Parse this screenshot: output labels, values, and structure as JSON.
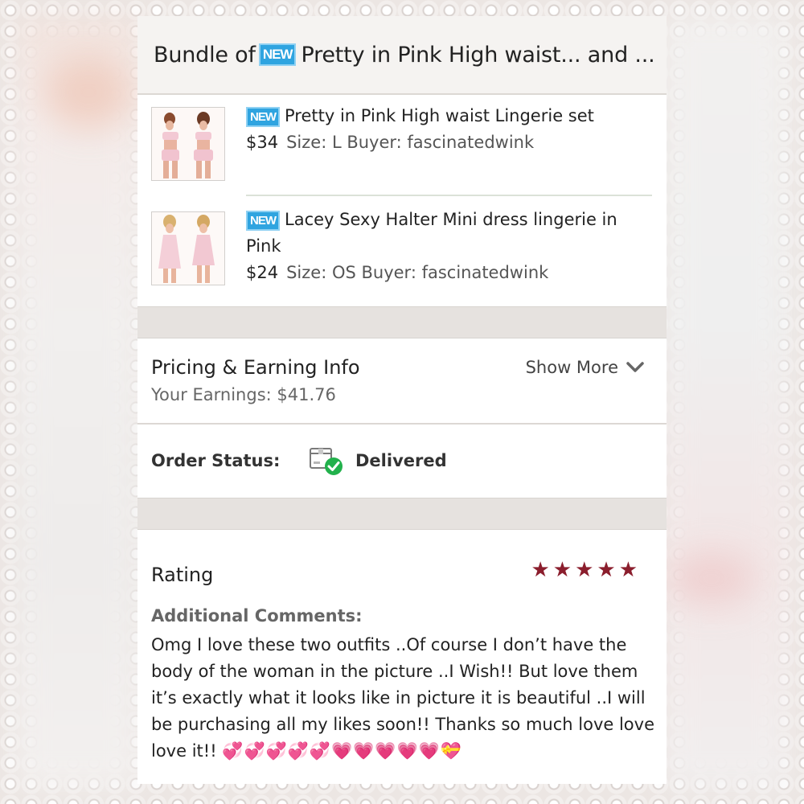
{
  "title": {
    "prefix": "Bundle of",
    "badge": "NEW",
    "text": "Pretty in Pink High waist... and ..."
  },
  "items": [
    {
      "badge": "NEW",
      "name": "Pretty in Pink High waist Lingerie set",
      "price": "$34",
      "meta": "Size: L  Buyer: fascinatedwink"
    },
    {
      "badge": "NEW",
      "name": "Lacey Sexy Halter Mini dress lingerie in Pink",
      "price": "$24",
      "meta": "Size: OS  Buyer: fascinatedwink"
    }
  ],
  "pricing": {
    "title": "Pricing & Earning Info",
    "earnings": "Your Earnings: $41.76",
    "show_more": "Show More"
  },
  "order": {
    "label": "Order Status:",
    "value": "Delivered",
    "icon": "package-delivered-icon"
  },
  "rating": {
    "label": "Rating",
    "stars": 5,
    "star_color": "#8b1e2d",
    "comments_label": "Additional Comments:",
    "comment": "Omg I love these two outfits ..Of course I don’t have the body of the woman in the picture ..I Wish!! But love them it’s exactly what it looks like in picture it is beautiful ..I will be purchasing all my likes soon!! Thanks so much love love love it!!",
    "emojis": "💞💞💞💞💞💗💗💗💗💗💝"
  },
  "colors": {
    "badge": "#2fa4e0",
    "delivered_check": "#22b14c",
    "accent": "#8b1e2d"
  }
}
